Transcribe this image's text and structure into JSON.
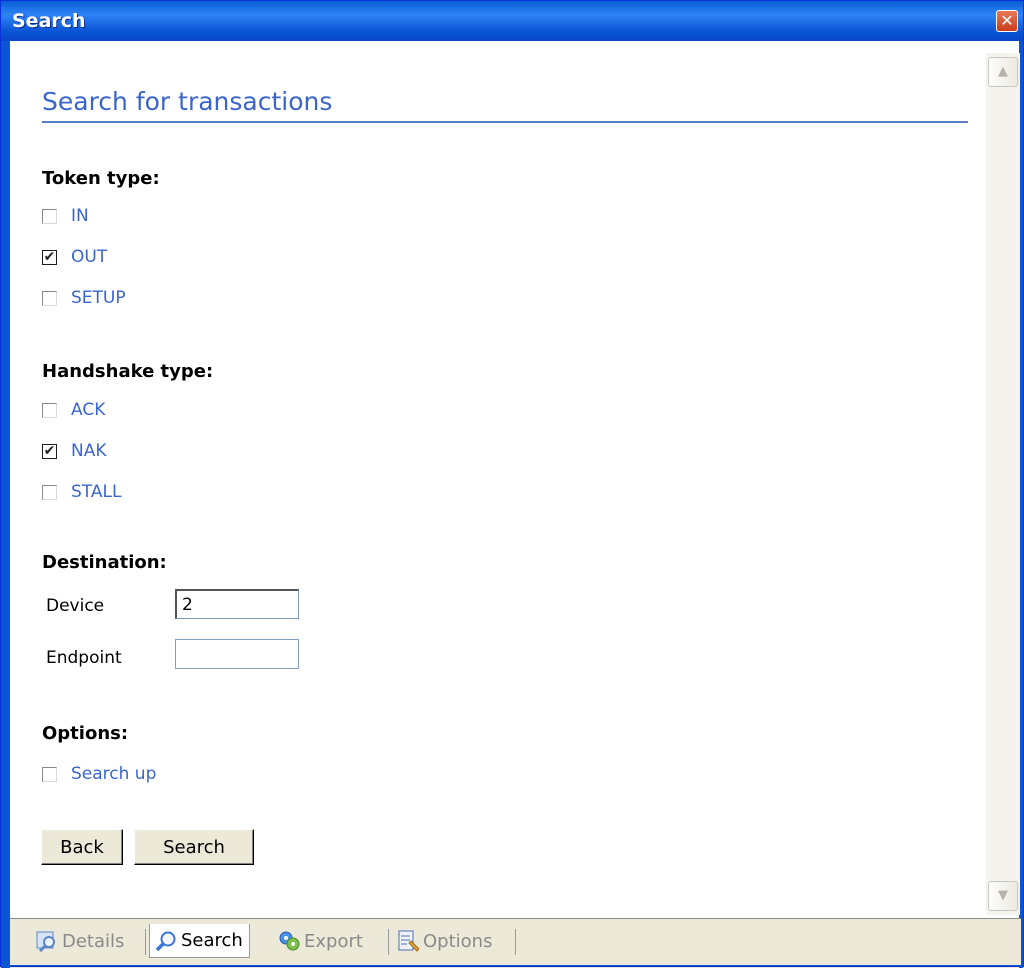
{
  "window": {
    "title": "Search",
    "close_glyph": "✕"
  },
  "page": {
    "title": "Search for transactions"
  },
  "token_type": {
    "label": "Token type:",
    "options": [
      {
        "label": "IN",
        "checked": false
      },
      {
        "label": "OUT",
        "checked": true
      },
      {
        "label": "SETUP",
        "checked": false
      }
    ]
  },
  "handshake_type": {
    "label": "Handshake type:",
    "options": [
      {
        "label": "ACK",
        "checked": false
      },
      {
        "label": "NAK",
        "checked": true
      },
      {
        "label": "STALL",
        "checked": false
      }
    ]
  },
  "destination": {
    "label": "Destination:",
    "device_label": "Device",
    "device_value": "2",
    "endpoint_label": "Endpoint",
    "endpoint_value": ""
  },
  "options": {
    "label": "Options:",
    "search_up": {
      "label": "Search up",
      "checked": false
    }
  },
  "buttons": {
    "back": "Back",
    "search": "Search"
  },
  "tabs": [
    {
      "label": "Details",
      "icon": "details-icon",
      "active": false
    },
    {
      "label": "Search",
      "icon": "magnifier-icon",
      "active": true
    },
    {
      "label": "Export",
      "icon": "export-icon",
      "active": false
    },
    {
      "label": "Options",
      "icon": "options-icon",
      "active": false
    }
  ],
  "colors": {
    "accent": "#3a66cc",
    "title_bar": "#0b55d4",
    "chrome": "#ece9d8"
  }
}
